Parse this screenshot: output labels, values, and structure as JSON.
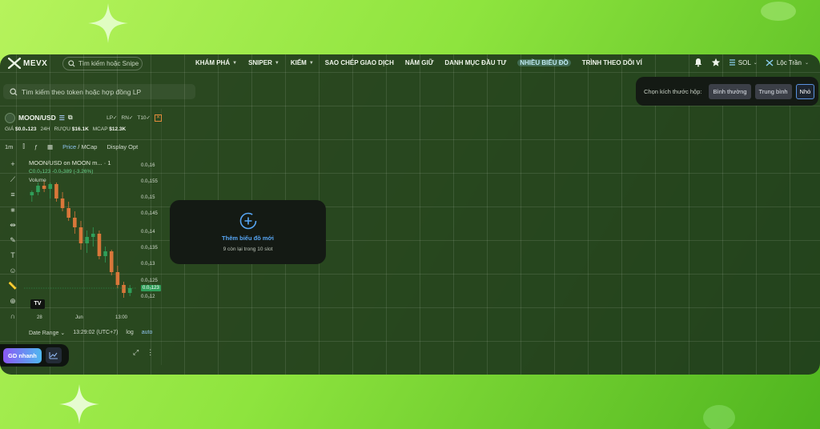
{
  "app": {
    "logo_text": "MEVX",
    "top_search_placeholder": "Tìm kiếm hoặc Snipe"
  },
  "nav": {
    "items": [
      {
        "label": "KHÁM PHÁ",
        "dropdown": true
      },
      {
        "label": "SNIPER",
        "dropdown": true
      },
      {
        "label": "KIẾM",
        "dropdown": true
      },
      {
        "label": "SAO CHÉP GIAO DỊCH",
        "dropdown": false
      },
      {
        "label": "NẮM GIỮ",
        "dropdown": false
      },
      {
        "label": "DANH MỤC ĐẦU TƯ",
        "dropdown": false
      },
      {
        "label": "NHIỀU BIỂU ĐỒ",
        "dropdown": false,
        "active": true
      },
      {
        "label": "TRÌNH THEO DÕI VÍ",
        "dropdown": false
      }
    ],
    "network": "SOL",
    "user_name": "Lộc Trần"
  },
  "token_search": {
    "placeholder": "Tìm kiếm theo token hoặc hợp đồng LP"
  },
  "size_selector": {
    "label": "Chọn kích thước hộp:",
    "options": [
      "Bình thường",
      "Trung bình",
      "Nhỏ"
    ],
    "selected": "Nhỏ"
  },
  "chart_panel": {
    "pair": "MOON/USD",
    "tags": [
      "LP✓",
      "RN✓",
      "T10✓"
    ],
    "stats": {
      "price_label": "GIÁ",
      "price": "$0.0₃123",
      "period": "24H",
      "vol_label": "RƯỢU",
      "vol": "$16.1K",
      "mcap_label": "MCAP",
      "mcap": "$12.3K"
    },
    "toolbar": {
      "interval": "1m",
      "price": "Price",
      "separator": "/",
      "mcap": "MCap",
      "display": "Display Opt"
    },
    "legend_title": "MOON/USD on MOON m... · 1",
    "legend_values": "C0.0₃123 -0.0₅389 (-3.26%)",
    "volume_label": "Volume",
    "y_ticks": [
      "0.0₃16",
      "0.0₃155",
      "0.0₃15",
      "0.0₃145",
      "0.0₃14",
      "0.0₃135",
      "0.0₃13",
      "0.0₃125",
      "0.0₃123",
      "0.0₃12"
    ],
    "x_ticks": [
      "28",
      "Jun",
      "13:00"
    ],
    "bottom": {
      "date_range": "Date Range",
      "time": "13:29:02 (UTC+7)",
      "log": "log",
      "auto": "auto"
    },
    "quick_trade": "GD nhanh"
  },
  "add_chart": {
    "title": "Thêm biểu đồ mới",
    "subtitle": "9 còn lại trong 10 slot"
  },
  "colors": {
    "up": "#2f9e59",
    "down": "#d9773a",
    "accent_blue": "#57a6f5"
  },
  "chart_data": {
    "type": "candlestick",
    "ohlc": [
      [
        0.000152,
        0.0001535,
        0.00015,
        0.000153
      ],
      [
        0.000153,
        0.000156,
        0.000152,
        0.000155
      ],
      [
        0.000155,
        0.0001565,
        0.000153,
        0.000154
      ],
      [
        0.000154,
        0.000156,
        0.000151,
        0.0001555
      ],
      [
        0.0001555,
        0.000156,
        0.00015,
        0.000151
      ],
      [
        0.000151,
        0.000153,
        0.000147,
        0.000148
      ],
      [
        0.000148,
        0.00015,
        0.000144,
        0.000145
      ],
      [
        0.000145,
        0.000147,
        0.00014,
        0.000142
      ],
      [
        0.000142,
        0.000144,
        0.000135,
        0.000137
      ],
      [
        0.000137,
        0.000141,
        0.000134,
        0.000139
      ],
      [
        0.000139,
        0.000142,
        0.000136,
        0.00014
      ],
      [
        0.00014,
        0.000141,
        0.000132,
        0.000133
      ],
      [
        0.000133,
        0.000136,
        0.000131,
        0.0001345
      ],
      [
        0.0001345,
        0.000135,
        0.000127,
        0.000128
      ],
      [
        0.000128,
        0.00013,
        0.000123,
        0.000124
      ],
      [
        0.000124,
        0.000125,
        0.00012,
        0.0001215
      ],
      [
        0.0001215,
        0.000124,
        0.0001205,
        0.000123
      ]
    ],
    "ylim": [
      0.000119,
      0.000161
    ],
    "last_price": 0.000123
  }
}
